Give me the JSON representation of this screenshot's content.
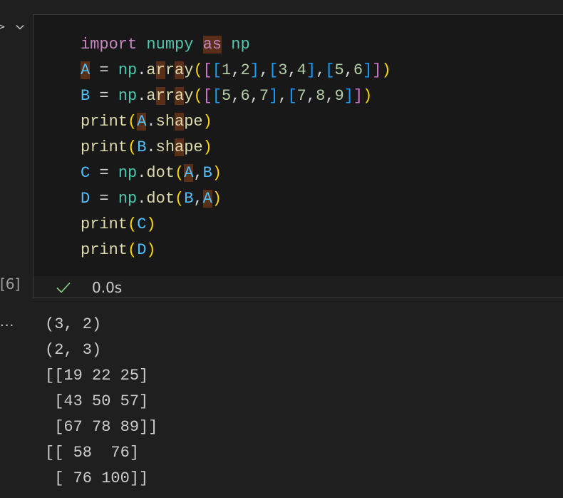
{
  "gutter": {
    "run_glyph": ">",
    "execution_count": "[6]",
    "output_menu": "..."
  },
  "cell": {
    "code_lines": [
      [
        {
          "t": "import",
          "c": "kw-import"
        },
        {
          "t": " ",
          "c": "op"
        },
        {
          "t": "numpy",
          "c": "mod"
        },
        {
          "t": " ",
          "c": "op"
        },
        {
          "t": "as",
          "c": "kw-import hl"
        },
        {
          "t": " ",
          "c": "op"
        },
        {
          "t": "np",
          "c": "mod"
        }
      ],
      [
        {
          "t": "A",
          "c": "var hl"
        },
        {
          "t": " = ",
          "c": "op"
        },
        {
          "t": "np",
          "c": "mod"
        },
        {
          "t": ".",
          "c": "op"
        },
        {
          "t": "a",
          "c": "fn"
        },
        {
          "t": "r",
          "c": "fn hl"
        },
        {
          "t": "r",
          "c": "fn"
        },
        {
          "t": "a",
          "c": "fn hl"
        },
        {
          "t": "y",
          "c": "fn"
        },
        {
          "t": "(",
          "c": "p1"
        },
        {
          "t": "[",
          "c": "p2"
        },
        {
          "t": "[",
          "c": "p3"
        },
        {
          "t": "1",
          "c": "num"
        },
        {
          "t": ",",
          "c": "op"
        },
        {
          "t": "2",
          "c": "num"
        },
        {
          "t": "]",
          "c": "p3"
        },
        {
          "t": ",",
          "c": "op"
        },
        {
          "t": "[",
          "c": "p3"
        },
        {
          "t": "3",
          "c": "num"
        },
        {
          "t": ",",
          "c": "op"
        },
        {
          "t": "4",
          "c": "num"
        },
        {
          "t": "]",
          "c": "p3"
        },
        {
          "t": ",",
          "c": "op"
        },
        {
          "t": "[",
          "c": "p3"
        },
        {
          "t": "5",
          "c": "num"
        },
        {
          "t": ",",
          "c": "op"
        },
        {
          "t": "6",
          "c": "num"
        },
        {
          "t": "]",
          "c": "p3"
        },
        {
          "t": "]",
          "c": "p2"
        },
        {
          "t": ")",
          "c": "p1"
        }
      ],
      [
        {
          "t": "B",
          "c": "var"
        },
        {
          "t": " = ",
          "c": "op"
        },
        {
          "t": "np",
          "c": "mod"
        },
        {
          "t": ".",
          "c": "op"
        },
        {
          "t": "a",
          "c": "fn"
        },
        {
          "t": "r",
          "c": "fn hl"
        },
        {
          "t": "r",
          "c": "fn"
        },
        {
          "t": "a",
          "c": "fn hl"
        },
        {
          "t": "y",
          "c": "fn"
        },
        {
          "t": "(",
          "c": "p1"
        },
        {
          "t": "[",
          "c": "p2"
        },
        {
          "t": "[",
          "c": "p3"
        },
        {
          "t": "5",
          "c": "num"
        },
        {
          "t": ",",
          "c": "op"
        },
        {
          "t": "6",
          "c": "num"
        },
        {
          "t": ",",
          "c": "op"
        },
        {
          "t": "7",
          "c": "num"
        },
        {
          "t": "]",
          "c": "p3"
        },
        {
          "t": ",",
          "c": "op"
        },
        {
          "t": "[",
          "c": "p3"
        },
        {
          "t": "7",
          "c": "num"
        },
        {
          "t": ",",
          "c": "op"
        },
        {
          "t": "8",
          "c": "num"
        },
        {
          "t": ",",
          "c": "op"
        },
        {
          "t": "9",
          "c": "num"
        },
        {
          "t": "]",
          "c": "p3"
        },
        {
          "t": "]",
          "c": "p2"
        },
        {
          "t": ")",
          "c": "p1"
        }
      ],
      [
        {
          "t": "print",
          "c": "fn"
        },
        {
          "t": "(",
          "c": "p1"
        },
        {
          "t": "A",
          "c": "var hl"
        },
        {
          "t": ".",
          "c": "op"
        },
        {
          "t": "s",
          "c": "fn"
        },
        {
          "t": "h",
          "c": "fn"
        },
        {
          "t": "a",
          "c": "fn hl"
        },
        {
          "t": "pe",
          "c": "fn"
        },
        {
          "t": ")",
          "c": "p1"
        }
      ],
      [
        {
          "t": "print",
          "c": "fn"
        },
        {
          "t": "(",
          "c": "p1"
        },
        {
          "t": "B",
          "c": "var"
        },
        {
          "t": ".",
          "c": "op"
        },
        {
          "t": "s",
          "c": "fn"
        },
        {
          "t": "h",
          "c": "fn"
        },
        {
          "t": "a",
          "c": "fn hl"
        },
        {
          "t": "pe",
          "c": "fn"
        },
        {
          "t": ")",
          "c": "p1"
        }
      ],
      [
        {
          "t": "C",
          "c": "var"
        },
        {
          "t": " = ",
          "c": "op"
        },
        {
          "t": "np",
          "c": "mod"
        },
        {
          "t": ".",
          "c": "op"
        },
        {
          "t": "dot",
          "c": "fn"
        },
        {
          "t": "(",
          "c": "p1"
        },
        {
          "t": "A",
          "c": "var hl"
        },
        {
          "t": ",",
          "c": "op"
        },
        {
          "t": "B",
          "c": "var"
        },
        {
          "t": ")",
          "c": "p1"
        }
      ],
      [
        {
          "t": "D",
          "c": "var"
        },
        {
          "t": " = ",
          "c": "op"
        },
        {
          "t": "np",
          "c": "mod"
        },
        {
          "t": ".",
          "c": "op"
        },
        {
          "t": "dot",
          "c": "fn"
        },
        {
          "t": "(",
          "c": "p1"
        },
        {
          "t": "B",
          "c": "var"
        },
        {
          "t": ",",
          "c": "op"
        },
        {
          "t": "A",
          "c": "var hl"
        },
        {
          "t": ")",
          "c": "p1"
        }
      ],
      [
        {
          "t": "print",
          "c": "fn"
        },
        {
          "t": "(",
          "c": "p1"
        },
        {
          "t": "C",
          "c": "var"
        },
        {
          "t": ")",
          "c": "p1"
        }
      ],
      [
        {
          "t": "print",
          "c": "fn"
        },
        {
          "t": "(",
          "c": "p1"
        },
        {
          "t": "D",
          "c": "var"
        },
        {
          "t": ")",
          "c": "p1"
        }
      ]
    ],
    "status": {
      "duration": "0.0s",
      "success_color": "#89d185"
    }
  },
  "output": {
    "lines": [
      "(3, 2)",
      "(2, 3)",
      "[[19 22 25]",
      " [43 50 57]",
      " [67 78 89]]",
      "[[ 58  76]",
      " [ 76 100]]"
    ]
  }
}
